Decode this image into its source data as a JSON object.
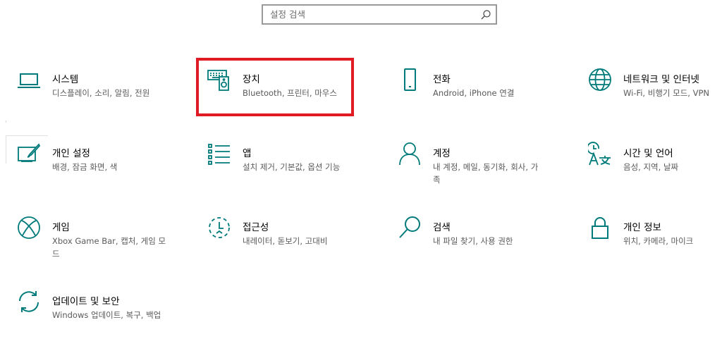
{
  "search": {
    "placeholder": "설정 검색",
    "icon": "search-icon"
  },
  "accent": "#007a7a",
  "highlight_color": "#e01b24",
  "tiles": [
    {
      "id": "system",
      "title": "시스템",
      "desc": "디스플레이, 소리, 알림, 전원",
      "icon": "laptop-icon"
    },
    {
      "id": "devices",
      "title": "장치",
      "desc": "Bluetooth, 프린터, 마우스",
      "icon": "devices-icon"
    },
    {
      "id": "phone",
      "title": "전화",
      "desc": "Android, iPhone 연결",
      "icon": "phone-icon"
    },
    {
      "id": "network",
      "title": "네트워크 및 인터넷",
      "desc": "Wi-Fi, 비행기 모드, VPN",
      "icon": "globe-icon"
    },
    {
      "id": "personalization",
      "title": "개인 설정",
      "desc": "배경, 잠금 화면, 색",
      "icon": "pen-tablet-icon"
    },
    {
      "id": "apps",
      "title": "앱",
      "desc": "설치 제거, 기본값, 옵션 기능",
      "icon": "apps-list-icon"
    },
    {
      "id": "accounts",
      "title": "계정",
      "desc": "내 계정, 메일, 동기화, 회사, 가\n족",
      "icon": "person-icon"
    },
    {
      "id": "time",
      "title": "시간 및 언어",
      "desc": "음성, 지역, 날짜",
      "icon": "time-language-icon"
    },
    {
      "id": "gaming",
      "title": "게임",
      "desc": "Xbox Game Bar, 캡처, 게임 모\n드",
      "icon": "xbox-icon"
    },
    {
      "id": "ease",
      "title": "접근성",
      "desc": "내레이터, 돋보기, 고대비",
      "icon": "ease-of-access-icon"
    },
    {
      "id": "search_tile",
      "title": "검색",
      "desc": "내 파일 찾기, 사용 권한",
      "icon": "magnifier-icon"
    },
    {
      "id": "privacy",
      "title": "개인 정보",
      "desc": "위치, 카메라, 마이크",
      "icon": "lock-icon"
    },
    {
      "id": "update",
      "title": "업데이트 및 보안",
      "desc": "Windows 업데이트, 복구, 백업",
      "icon": "sync-icon"
    }
  ]
}
